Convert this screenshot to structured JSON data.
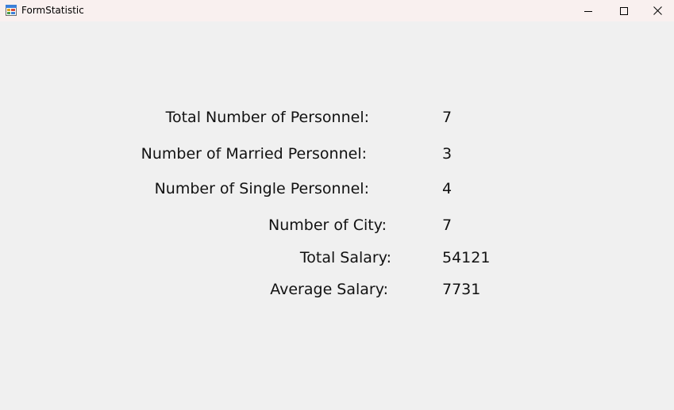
{
  "window": {
    "title": "FormStatistic"
  },
  "stats": {
    "total_personnel": {
      "label": "Total Number of Personnel:",
      "value": "7"
    },
    "married_personnel": {
      "label": "Number of Married Personnel:",
      "value": "3"
    },
    "single_personnel": {
      "label": "Number of Single Personnel:",
      "value": "4"
    },
    "city_count": {
      "label": "Number of City:",
      "value": "7"
    },
    "total_salary": {
      "label": "Total Salary:",
      "value": "54121"
    },
    "average_salary": {
      "label": "Average Salary:",
      "value": "7731"
    }
  },
  "icons": {
    "app": "form-app-icon",
    "minimize": "minimize-icon",
    "maximize": "maximize-icon",
    "close": "close-icon"
  }
}
